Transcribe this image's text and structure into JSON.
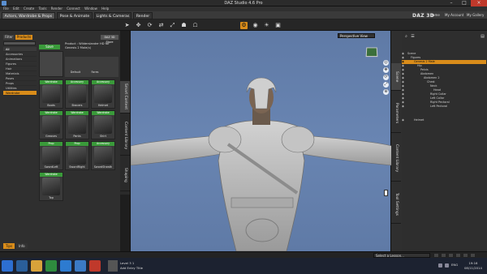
{
  "window": {
    "title": "DAZ Studio 4.6 Pro"
  },
  "menu": [
    "File",
    "Edit",
    "Create",
    "Tools",
    "Render",
    "Connect",
    "Window",
    "Help"
  ],
  "rooms": [
    "Actors, Wardrobe & Props",
    "Pose & Animate",
    "Lights & Cameras",
    "Render"
  ],
  "brand": "DAZ 3D",
  "top_links": [
    "Home",
    "My Account",
    "My Gallery"
  ],
  "left": {
    "filter_tabs": [
      "Filter",
      "Products"
    ],
    "cc_button": "DAZ 3D Store",
    "categories": [
      "All",
      "Accessories",
      "Animations",
      "Figures",
      "Hair",
      "Materials",
      "Poses",
      "Props",
      "Utilities",
      "Wardrobe"
    ],
    "selected_category": "Wardrobe",
    "save_label": "Save",
    "product_text": "Product : Wilderslander HD for Genesis 2 Male(s)",
    "product_thumbs": [
      "Default",
      "Fares"
    ],
    "tiles": [
      {
        "badge": "Wardrobe",
        "name": "Boots"
      },
      {
        "badge": "Accessory",
        "name": "Bracers"
      },
      {
        "badge": "Accessory",
        "name": "Helmet"
      },
      {
        "badge": "Wardrobe",
        "name": "Greaves"
      },
      {
        "badge": "Wardrobe",
        "name": "Pants"
      },
      {
        "badge": "Wardrobe",
        "name": "Shirt"
      },
      {
        "badge": "Prop",
        "name": "SwordLeft"
      },
      {
        "badge": "Prop",
        "name": "SwordRight"
      },
      {
        "badge": "Accessory",
        "name": "SwordSheath"
      },
      {
        "badge": "Wardrobe",
        "name": "Top"
      }
    ],
    "side_tabs": [
      "Smart Content",
      "Content Library",
      "Shaping"
    ],
    "foot_tabs": [
      "Tips",
      "Info"
    ]
  },
  "viewport": {
    "view_label": "Perspective View",
    "nav_buttons": [
      "◎",
      "✥",
      "⟳",
      "⤢",
      "⊕"
    ]
  },
  "right": {
    "side_tabs": [
      "Scene",
      "Parameters",
      "Content Library",
      "Tool Settings"
    ],
    "tree": [
      {
        "indent": 0,
        "label": "Scene"
      },
      {
        "indent": 1,
        "label": "Figures"
      },
      {
        "indent": 2,
        "label": "Genesis 2 Male",
        "selected": true
      },
      {
        "indent": 3,
        "label": "Hip"
      },
      {
        "indent": 4,
        "label": "Pelvis"
      },
      {
        "indent": 4,
        "label": "Abdomen"
      },
      {
        "indent": 5,
        "label": "Abdomen 2"
      },
      {
        "indent": 6,
        "label": "Chest"
      },
      {
        "indent": 7,
        "label": "Neck"
      },
      {
        "indent": 8,
        "label": "Head"
      },
      {
        "indent": 7,
        "label": "Right Collar"
      },
      {
        "indent": 7,
        "label": "Left Collar"
      },
      {
        "indent": 7,
        "label": "Right Pectoral"
      },
      {
        "indent": 7,
        "label": "Left Pectoral"
      },
      {
        "indent": 2,
        "label": "Helmet"
      }
    ]
  },
  "status": {
    "lesson_placeholder": "Select a Lesson..."
  },
  "taskbar": {
    "window_text": [
      "Level 3 1",
      "Add Entry Title"
    ],
    "time": "19:16",
    "date": "08/11/2014",
    "lang": "ENG"
  }
}
